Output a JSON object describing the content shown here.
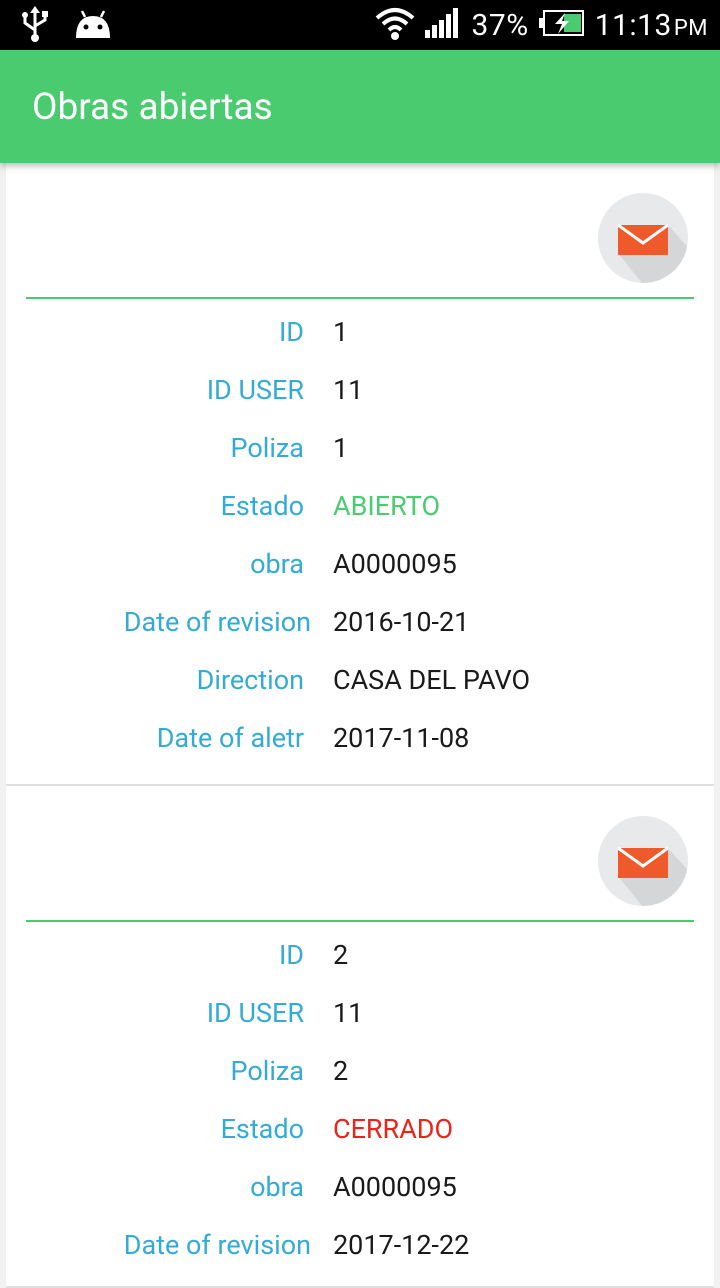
{
  "status_bar": {
    "battery": "37%",
    "time": "11:13",
    "ampm": "PM"
  },
  "app_bar": {
    "title": "Obras abiertas"
  },
  "labels": {
    "id": "ID",
    "id_user": "ID USER",
    "poliza": "Poliza",
    "estado": "Estado",
    "obra": "obra",
    "date_revision": "Date of revision",
    "direction": "Direction",
    "date_alert": "Date of aletr"
  },
  "colors": {
    "accent": "#4acb70",
    "label": "#34abd6",
    "open": "#4acb70",
    "closed": "#e8241c",
    "mail": "#ee5a2b"
  },
  "obras": [
    {
      "id": "1",
      "id_user": "11",
      "poliza": "1",
      "estado": "ABIERTO",
      "obra": "A0000095",
      "date_revision": "2016-10-21",
      "direction": "CASA DEL PAVO",
      "date_alert": "2017-11-08"
    },
    {
      "id": "2",
      "id_user": "11",
      "poliza": "2",
      "estado": "CERRADO",
      "obra": "A0000095",
      "date_revision": "2017-12-22"
    }
  ]
}
